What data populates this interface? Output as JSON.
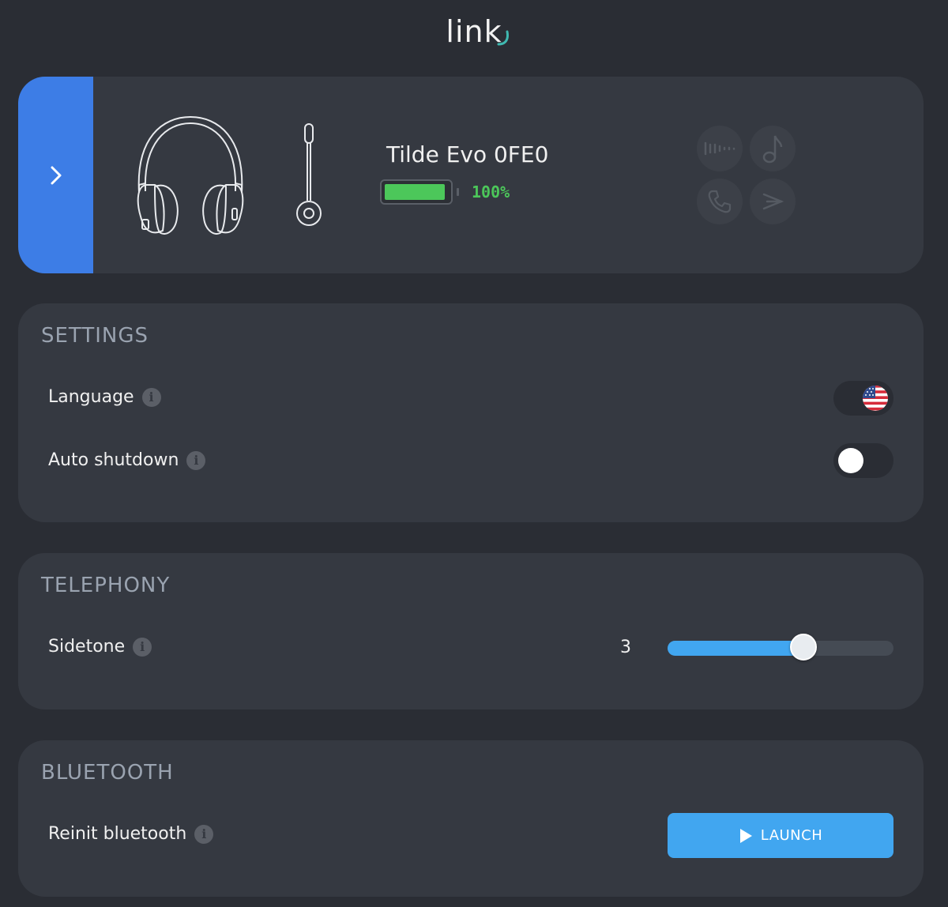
{
  "app": {
    "logo_text": "link",
    "accent": "#3d7de6"
  },
  "device": {
    "name": "Tilde Evo 0FE0",
    "battery_percent": 100,
    "battery_label": "100%",
    "battery_color": "#4cc75a",
    "mode_icons": [
      "waveform-icon",
      "music-note-icon",
      "phone-icon",
      "noise-reduction-icon"
    ]
  },
  "settings": {
    "title": "SETTINGS",
    "language": {
      "label": "Language",
      "value_icon": "us-flag-icon"
    },
    "auto_shutdown": {
      "label": "Auto shutdown",
      "enabled": false
    }
  },
  "telephony": {
    "title": "TELEPHONY",
    "sidetone": {
      "label": "Sidetone",
      "value": "3",
      "min": 0,
      "max": 5,
      "current": 3
    }
  },
  "bluetooth": {
    "title": "BLUETOOTH",
    "reinit": {
      "label": "Reinit bluetooth",
      "button_label": "LAUNCH"
    }
  },
  "info_glyph": "i"
}
